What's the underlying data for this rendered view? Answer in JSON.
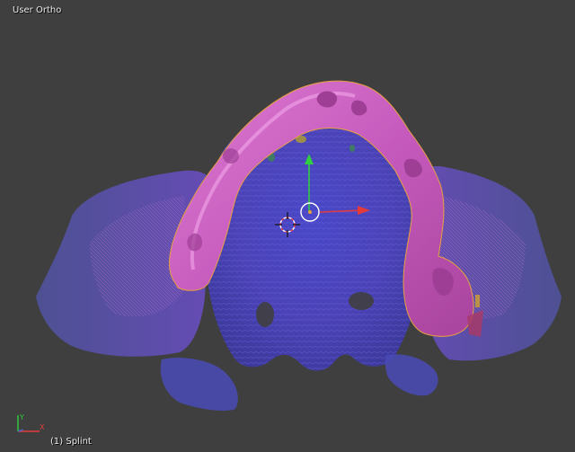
{
  "viewport": {
    "view_name": "User Ortho",
    "active_object": "(1) Splint"
  },
  "colors": {
    "background": "#3f3f3f",
    "palate": "#5a50c8",
    "splint": "#c45ab8",
    "transform_x": "#e33b3b",
    "transform_y": "#2fcf3f",
    "axis_z": "#3a6ad6"
  },
  "icons": {
    "cursor": "3d-cursor-icon",
    "manipulator": "transform-manipulator-icon",
    "axes": "view-axes-icon"
  }
}
